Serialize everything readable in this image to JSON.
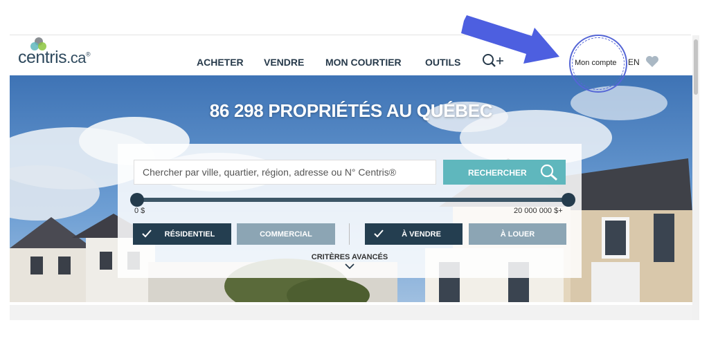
{
  "brand": {
    "logo_main": "centris",
    "logo_suffix": ".ca",
    "logo_mark": "®",
    "colors": {
      "primary": "#26394a",
      "accent": "#5fb7bd",
      "active_toggle": "#243e50",
      "inactive_toggle": "#8ca5b4",
      "annotation": "#4d5fe0"
    }
  },
  "nav": {
    "items": [
      {
        "label": "ACHETER"
      },
      {
        "label": "VENDRE"
      },
      {
        "label": "MON COURTIER"
      },
      {
        "label": "OUTILS"
      }
    ],
    "search_icon": "search-plus-icon",
    "account_label": "Mon compte",
    "language_label": "EN",
    "favorites_icon": "heart-icon"
  },
  "hero": {
    "title": "86 298 PROPRIÉTÉS AU QUÉBEC"
  },
  "search": {
    "placeholder": "Chercher par ville, quartier, région, adresse ou N° Centris®",
    "button_label": "RECHERCHER",
    "button_icon": "search-icon"
  },
  "price_range": {
    "min_label": "0 $",
    "max_label": "20 000 000 $+"
  },
  "filters": {
    "residential": "RÉSIDENTIEL",
    "commercial": "COMMERCIAL",
    "for_sale": "À VENDRE",
    "for_rent": "À LOUER",
    "advanced": "CRITÈRES AVANCÉS"
  }
}
